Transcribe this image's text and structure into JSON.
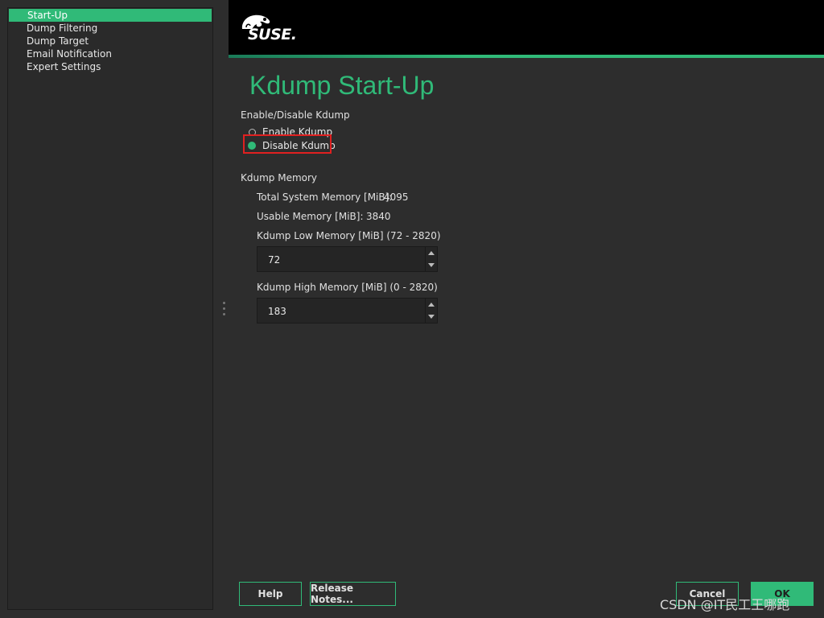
{
  "sidebar": {
    "items": [
      {
        "label": "Start-Up",
        "active": true
      },
      {
        "label": "Dump Filtering",
        "active": false
      },
      {
        "label": "Dump Target",
        "active": false
      },
      {
        "label": "Email Notification",
        "active": false
      },
      {
        "label": "Expert Settings",
        "active": false
      }
    ]
  },
  "header": {
    "logo_text": "SUSE.",
    "logo_icon": "chameleon-logo"
  },
  "page": {
    "title": "Kdump Start-Up",
    "enable_group_label": "Enable/Disable Kdump",
    "radio_enable_label": "Enable Kdump",
    "radio_disable_label": "Disable Kdump",
    "selected": "disable",
    "memory_group_label": "Kdump Memory",
    "total_memory_label": "Total System Memory [MiB]:",
    "total_memory_value": "4095",
    "usable_memory_label": "Usable Memory [MiB]:",
    "usable_memory_value": "3840",
    "low_memory_label": "Kdump Low Memory [MiB] (72 - 2820)",
    "low_memory_value": "72",
    "high_memory_label": "Kdump High Memory [MiB] (0 - 2820)",
    "high_memory_value": "183"
  },
  "buttons": {
    "help": "Help",
    "release_notes": "Release Notes...",
    "cancel": "Cancel",
    "ok": "OK"
  },
  "watermark": "CSDN @IT民工王哪跑",
  "colors": {
    "accent": "#30ba78",
    "highlight_box": "#e02020",
    "background": "#2d2d2d"
  }
}
